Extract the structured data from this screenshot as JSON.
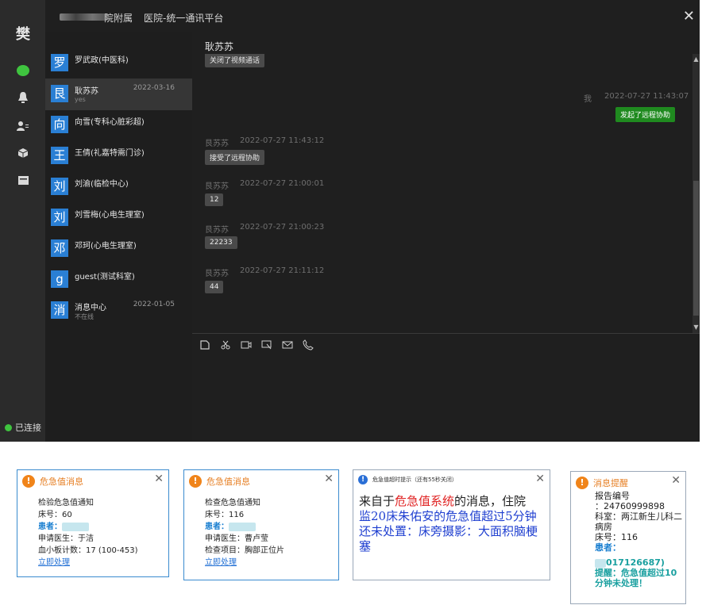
{
  "window": {
    "title": "医院-统一通讯平台",
    "title_prefix_masked": "院附属",
    "close_glyph": "✕"
  },
  "user": {
    "avatar_char": "樊",
    "status": "已连接"
  },
  "nav_icons": [
    "chat-bubble-icon",
    "bell-icon",
    "contacts-icon",
    "cube-icon",
    "folder-icon"
  ],
  "contacts": [
    {
      "avatar": "罗",
      "name": "罗武政(中医科)",
      "sub": "",
      "date": ""
    },
    {
      "avatar": "艮",
      "name": "耿苏苏",
      "sub": "yes",
      "date": "2022-03-16",
      "active": true
    },
    {
      "avatar": "向",
      "name": "向雪(专科心脏彩超)",
      "sub": "",
      "date": ""
    },
    {
      "avatar": "王",
      "name": "王倩(礼嘉特需门诊)",
      "sub": "",
      "date": ""
    },
    {
      "avatar": "刘",
      "name": "刘渝(临检中心)",
      "sub": "",
      "date": ""
    },
    {
      "avatar": "刘",
      "name": "刘雪梅(心电生理室)",
      "sub": "",
      "date": ""
    },
    {
      "avatar": "邓",
      "name": "邓珂(心电生理室)",
      "sub": "",
      "date": ""
    },
    {
      "avatar": "g",
      "name": "guest(测试科室)",
      "sub": "",
      "date": ""
    },
    {
      "avatar": "消",
      "name": "消息中心",
      "sub": "不在线",
      "date": "2022-01-05"
    }
  ],
  "chat": {
    "peer_name": "耿苏苏",
    "messages": [
      {
        "sender": "",
        "time": "",
        "text": "关闭了视频通话",
        "mine": false
      },
      {
        "sender": "我",
        "time": "2022-07-27 11:43:07",
        "text": "发起了远程协助",
        "mine": true
      },
      {
        "sender": "艮苏苏",
        "time": "2022-07-27 11:43:12",
        "text": "接受了远程协助",
        "mine": false
      },
      {
        "sender": "艮苏苏",
        "time": "2022-07-27 21:00:01",
        "text": "12",
        "mine": false
      },
      {
        "sender": "艮苏苏",
        "time": "2022-07-27 21:00:23",
        "text": "22233",
        "mine": false
      },
      {
        "sender": "艮苏苏",
        "time": "2022-07-27 21:11:12",
        "text": "44",
        "mine": false
      }
    ],
    "toolbar": [
      "file-icon",
      "scissors-icon",
      "video-icon",
      "screen-share-icon",
      "mail-icon",
      "phone-icon"
    ]
  },
  "popups": {
    "p1": {
      "title": "危急值消息",
      "heading": "检验危急值通知",
      "bed": "床号：60",
      "patient_label": "患者：",
      "doctor": "申请医生：于洁",
      "item": "血小板计数：17 (100-453)",
      "action": "立即处理"
    },
    "p2": {
      "title": "危急值消息",
      "heading": "检查危急值通知",
      "bed": "床号：116",
      "patient_label": "患者：",
      "doctor": "申请医生：曹卢莹",
      "item": "检查项目：胸部正位片",
      "action": "立即处理"
    },
    "p3": {
      "title": "危急值超时提示（还有55秒关闭）",
      "line1a": "来自于",
      "line1b": "危急值系统",
      "line1c": "的消息，住院",
      "line2": "监20床朱佑安的危急值超过5分钟还未处置：床旁摄影：大面积脑梗塞"
    },
    "p4": {
      "title": "消息提醒",
      "l1": "报告编号",
      "l2": "：24760999898",
      "l3": "科室：两江新生儿科二病房",
      "l4": "床号：116",
      "l5": "患者：",
      "l6": "017126687)",
      "l7": "提醒：危急值超过10分钟未处理！"
    }
  },
  "colors": {
    "accent_blue": "#2a7fd4",
    "online_green": "#3fc43f",
    "warning_orange": "#f0841a"
  }
}
